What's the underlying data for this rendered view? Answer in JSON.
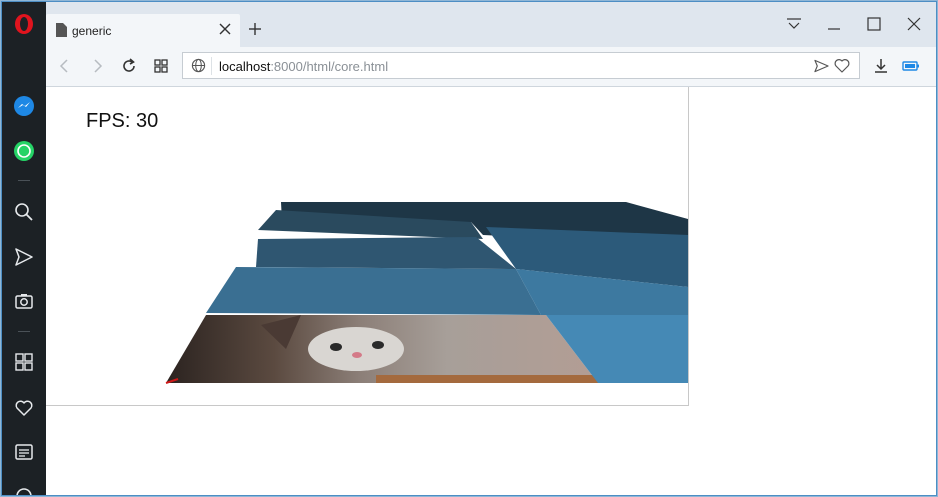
{
  "browser": {
    "name": "Opera",
    "tab": {
      "title": "generic"
    },
    "address": {
      "host": "localhost",
      "rest": ":8000/html/core.html"
    }
  },
  "sidebar": {
    "items": [
      {
        "icon": "messenger-icon"
      },
      {
        "icon": "whatsapp-icon"
      },
      {
        "icon": "search-icon"
      },
      {
        "icon": "send-icon"
      },
      {
        "icon": "camera-icon"
      },
      {
        "icon": "speed-dial-icon"
      },
      {
        "icon": "heart-icon"
      },
      {
        "icon": "news-icon"
      }
    ]
  },
  "page": {
    "fps_label": "FPS: 30"
  },
  "colors": {
    "accent": "#2d7fbf",
    "sidebar_bg": "#1c2125",
    "tabbar_bg": "#dfe6ee",
    "opera_red": "#e0141e",
    "messenger_blue": "#1e88e5",
    "whatsapp_green": "#25d366"
  }
}
